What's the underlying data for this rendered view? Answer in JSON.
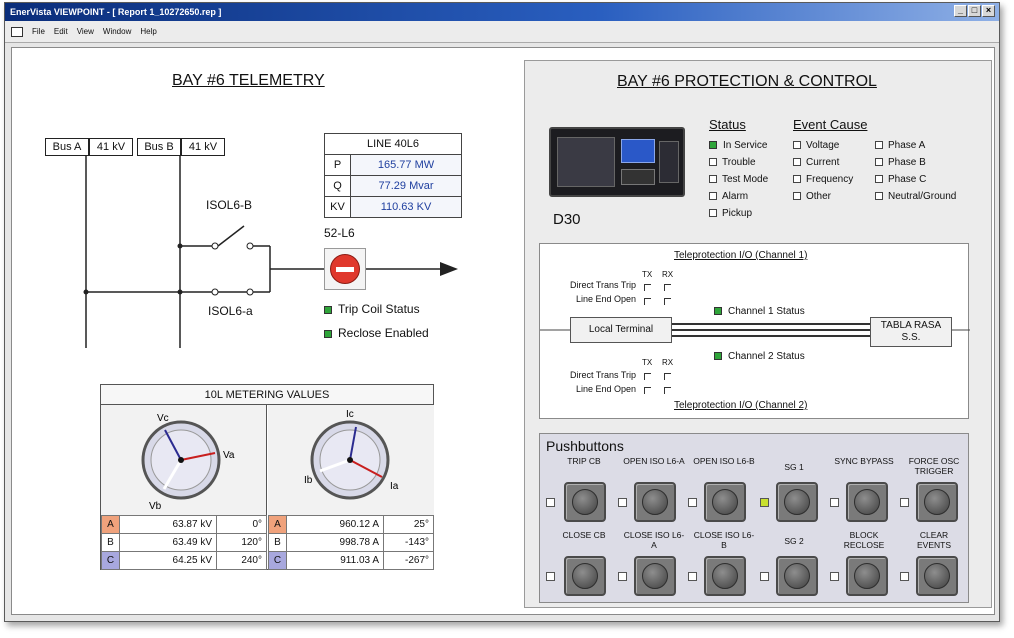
{
  "window": {
    "title": "EnerVista VIEWPOINT - [ Report 1_10272650.rep ]",
    "buttons": [
      "_",
      "□",
      "×"
    ]
  },
  "menu": {
    "items": [
      "File",
      "Edit",
      "View",
      "Window",
      "Help"
    ]
  },
  "telemetry": {
    "title": "BAY #6 TELEMETRY",
    "bus_a": {
      "name": "Bus A",
      "kv": "41 kV"
    },
    "bus_b": {
      "name": "Bus B",
      "kv": "41 kV"
    },
    "switch_b": "ISOL6-B",
    "switch_a": "ISOL6-a",
    "breaker_name": "52-L6",
    "line": {
      "name": "LINE 40L6",
      "rows": [
        {
          "label": "P",
          "value": "165.77 MW"
        },
        {
          "label": "Q",
          "value": "77.29 Mvar"
        },
        {
          "label": "KV",
          "value": "110.63 KV"
        }
      ]
    },
    "indicators": [
      {
        "label": "Trip Coil Status",
        "state": "on"
      },
      {
        "label": "Reclose Enabled",
        "state": "on"
      }
    ]
  },
  "metering": {
    "title": "10L METERING VALUES",
    "voltage_phasor_labels": {
      "a": "Vc",
      "b": "Vb",
      "c": "Va"
    },
    "current_phasor_labels": {
      "a": "Ic",
      "b": "Ib",
      "c": "Ia"
    },
    "voltage": [
      {
        "phase": "A",
        "mag": "63.87 kV",
        "ang": "0°"
      },
      {
        "phase": "B",
        "mag": "63.49 kV",
        "ang": "120°"
      },
      {
        "phase": "C",
        "mag": "64.25 kV",
        "ang": "240°"
      }
    ],
    "current": [
      {
        "phase": "A",
        "mag": "960.12 A",
        "ang": "25°"
      },
      {
        "phase": "B",
        "mag": "998.78 A",
        "ang": "-143°"
      },
      {
        "phase": "C",
        "mag": "911.03 A",
        "ang": "-267°"
      }
    ]
  },
  "protection": {
    "title": "BAY #6 PROTECTION & CONTROL",
    "device_name": "D30",
    "status_header": "Status",
    "status_items": [
      {
        "label": "In Service",
        "state": "on"
      },
      {
        "label": "Trouble",
        "state": "off"
      },
      {
        "label": "Test Mode",
        "state": "off"
      },
      {
        "label": "Alarm",
        "state": "off"
      },
      {
        "label": "Pickup",
        "state": "off"
      }
    ],
    "event_header": "Event Cause",
    "event_col1": [
      "Voltage",
      "Current",
      "Frequency",
      "Other"
    ],
    "event_col2": [
      "Phase A",
      "Phase B",
      "Phase C",
      "Neutral/Ground"
    ]
  },
  "teleprotection": {
    "channel1_caption": "Teleprotection I/O (Channel 1)",
    "channel2_caption": "Teleprotection I/O (Channel 2)",
    "tx": "TX",
    "rx": "RX",
    "direct_trans_trip": "Direct Trans Trip",
    "line_end_open": "Line End Open",
    "local_terminal": "Local Terminal",
    "remote_terminal": "TABLA RASA S.S.",
    "channel1_status": "Channel 1 Status",
    "channel2_status": "Channel 2 Status"
  },
  "pushbuttons": {
    "title": "Pushbuttons",
    "row1": [
      {
        "label": "TRIP CB",
        "led": "off"
      },
      {
        "label": "OPEN ISO L6-A",
        "led": "off"
      },
      {
        "label": "OPEN ISO L6-B",
        "led": "off"
      },
      {
        "label": "SG 1",
        "led": "on"
      },
      {
        "label": "SYNC BYPASS",
        "led": "off"
      },
      {
        "label": "FORCE OSC TRIGGER",
        "led": "off"
      }
    ],
    "row2": [
      {
        "label": "CLOSE CB",
        "led": "off"
      },
      {
        "label": "CLOSE ISO L6-A",
        "led": "off"
      },
      {
        "label": "CLOSE ISO L6-B",
        "led": "off"
      },
      {
        "label": "SG 2",
        "led": "off"
      },
      {
        "label": "BLOCK RECLOSE",
        "led": "off"
      },
      {
        "label": "CLEAR EVENTS",
        "led": "off"
      }
    ]
  },
  "colors": {
    "indicator_on": "#2fa53a",
    "led_lit": "#c9e12f",
    "phase_a": "#f0a27c",
    "phase_c": "#a8a8de",
    "breaker_red": "#e0382c"
  }
}
